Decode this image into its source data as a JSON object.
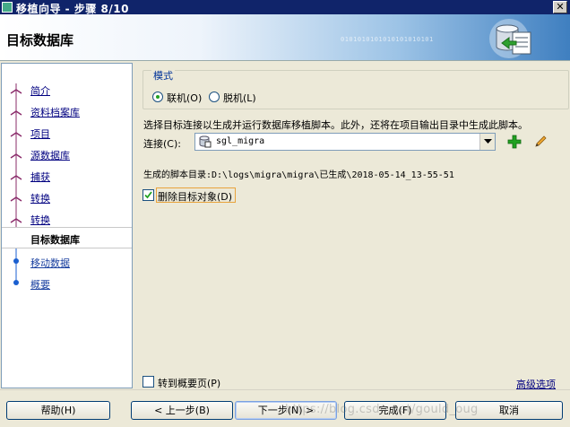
{
  "window": {
    "title": "移植向导 - 步骤 8/10",
    "close_glyph": "✕"
  },
  "header": {
    "heading": "目标数据库",
    "decoration_text": "0101010101010101010101"
  },
  "nav": {
    "items": [
      {
        "label": "简介",
        "state": "done"
      },
      {
        "label": "资料档案库",
        "state": "done"
      },
      {
        "label": "项目",
        "state": "done"
      },
      {
        "label": "源数据库",
        "state": "done"
      },
      {
        "label": "捕获",
        "state": "done"
      },
      {
        "label": "转换",
        "state": "done"
      },
      {
        "label": "转换",
        "state": "done"
      },
      {
        "label": "目标数据库",
        "state": "current"
      },
      {
        "label": "移动数据",
        "state": "future"
      },
      {
        "label": "概要",
        "state": "future"
      }
    ]
  },
  "mode": {
    "title": "模式",
    "online_label": "联机(O)",
    "offline_label": "脱机(L)",
    "selected": "online"
  },
  "description": "选择目标连接以生成并运行数据库移植脚本。此外，还将在项目输出目录中生成此脚本。",
  "connection": {
    "label": "连接(C):",
    "value": "sgl_migra"
  },
  "script_dir": {
    "text": "生成的脚本目录:D:\\logs\\migra\\migra\\已生成\\2018-05-14_13-55-51"
  },
  "drop_objects": {
    "label": "删除目标对象(D)",
    "checked": true
  },
  "goto_summary": {
    "label": "转到概要页(P)",
    "checked": false
  },
  "advanced_link": "高级选项",
  "footer": {
    "help": "帮助(H)",
    "back": "< 上一步(B)",
    "next": "下一步(N) >",
    "finish": "完成(F)",
    "cancel": "取消"
  },
  "watermark": "https://blog.csdn.net/gould_oug",
  "colors": {
    "title_bar": "#10246a",
    "link": "#000080",
    "add_icon": "#21a121",
    "nav_done_node": "#8a2b6a",
    "nav_future_node": "#1a5fd0"
  },
  "icons": {
    "add": "plus-icon",
    "edit": "pencil-icon",
    "connection": "database-icon",
    "header": "database-graphic-icon"
  }
}
